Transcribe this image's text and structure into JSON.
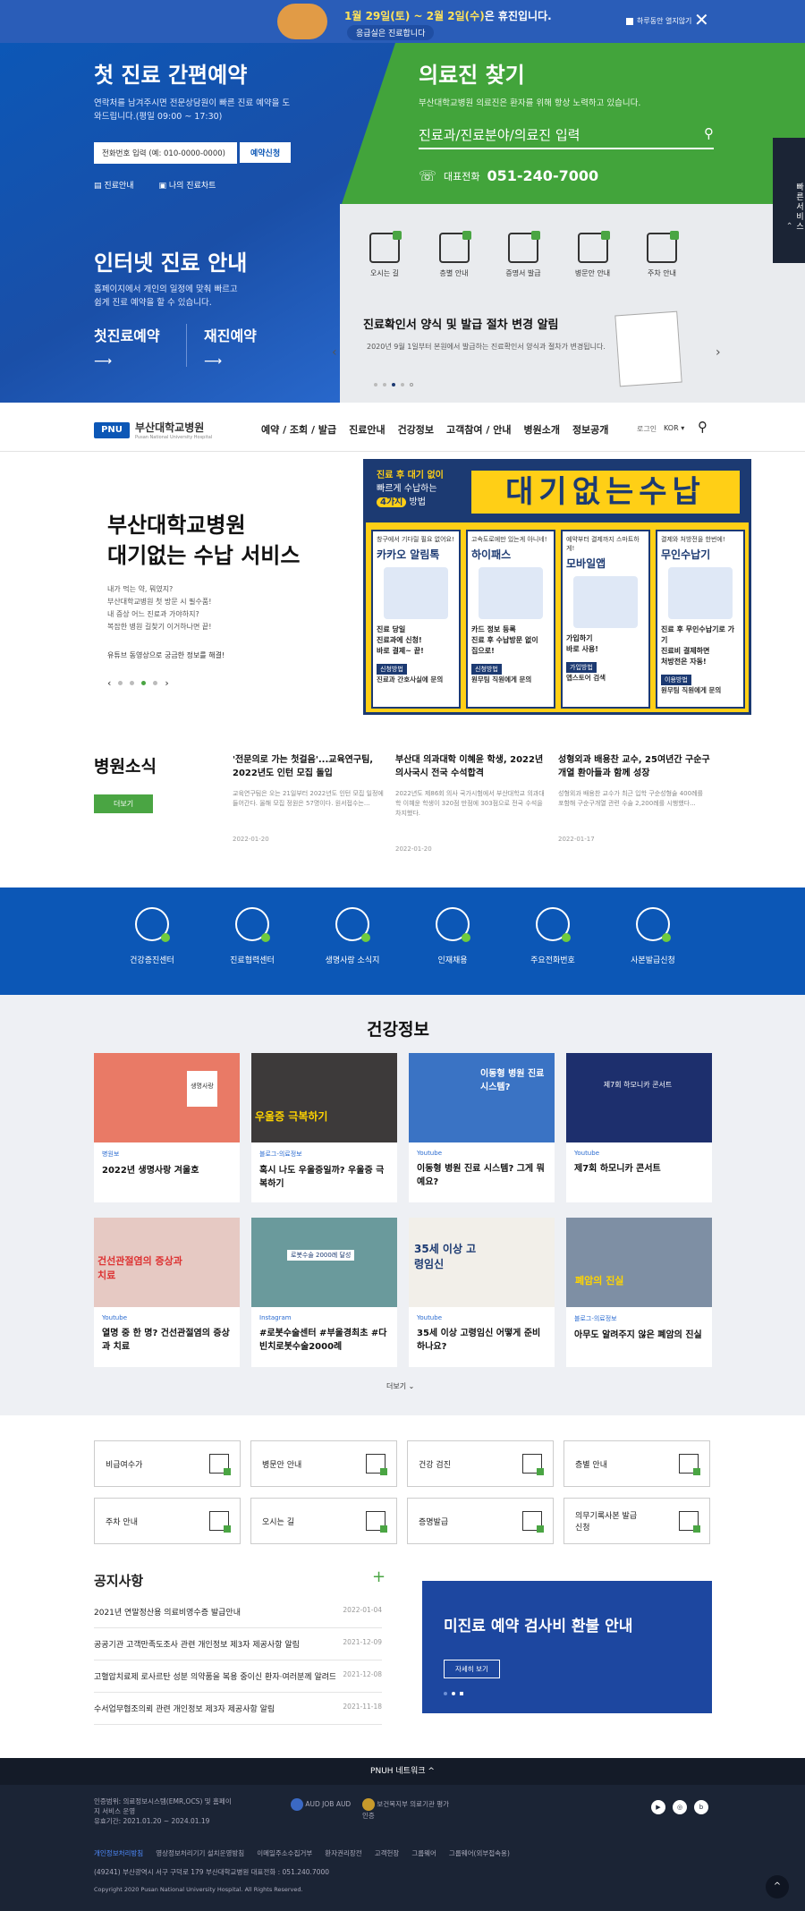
{
  "topnotice": {
    "pre": "1월 29일(토) ~ 2월 2일(수)",
    "post": "은 휴진입니다.",
    "pill": "응급실은 진료합니다",
    "today_hide": "하루동안 열지않기"
  },
  "hero": {
    "reserve": {
      "title": "첫 진료 간편예약",
      "desc": "연락처를 남겨주시면 전문상담원이 빠른 진료 예약을 도와드립니다.(평일 09:00 ~ 17:30)",
      "phone_placeholder": "전화번호 입력 (예: 010-0000-0000)",
      "apply": "예약신청",
      "link1": "진료안내",
      "link2": "나의 진료차트"
    },
    "find": {
      "title": "의료진 찾기",
      "desc": "부산대학교병원 의료진은 환자를 위해 항상 노력하고 있습니다.",
      "search_placeholder": "진료과/진료분야/의료진 입력",
      "tel_label": "대표전화",
      "tel": "051-240-7000"
    },
    "internet": {
      "title": "인터넷 진료 안내",
      "desc1": "홈페이지에서 개인의 일정에 맞춰 빠르고",
      "desc2": "쉽게 진료 예약을 할 수 있습니다.",
      "first": "첫진료예약",
      "re": "재진예약"
    },
    "icons": [
      "오시는 길",
      "층별 안내",
      "증명서 발급",
      "병문안 안내",
      "주차 안내"
    ],
    "slide": {
      "title": "진료확인서 양식 및 발급 절차 변경 알림",
      "desc": "2020년 9월 1일부터 본원에서 발급하는 진료확인서 양식과 절차가 변경됩니다."
    },
    "sidetab": "빠른서비스"
  },
  "gnb": {
    "logo_mark": "PNU",
    "logo_kr": "부산대학교병원",
    "logo_en": "Pusan National University Hospital",
    "menu": [
      "예약 / 조회 / 발급",
      "진료안내",
      "건강정보",
      "고객참여 / 안내",
      "병원소개",
      "정보공개"
    ],
    "login": "로그인",
    "lang": "KOR"
  },
  "main_banner": {
    "title1": "부산대학교병원",
    "title2": "대기없는 수납 서비스",
    "lines": [
      "내가 먹는 약, 뭐였지?",
      "부산대학교병원 첫 방문 시 필수품!",
      "내 증상 어느 진료과 가야하지?",
      "복잡한 병원 길찾기 이거하나면 끝!"
    ],
    "note": "유튜브 동영상으로 궁금한 정보를 해결!",
    "yb_small1": "진료 후 대기 없이",
    "yb_small2": "빠르게 수납하는",
    "yb_badge": "4가지",
    "yb_small3": "방법",
    "yb_big": "대기없는수납",
    "cards": [
      {
        "top": "창구에서 기다릴 필요 없어요!",
        "name": "카카오 알림톡",
        "f1": "진료 당일",
        "f2": "진료과에 신청!",
        "f3": "바로 결제~ 끝!",
        "tag": "신청방법",
        "foot": "진료과 간호사실에 문의"
      },
      {
        "top": "고속도로에만 있는게 아니네!",
        "name": "하이패스",
        "f1": "카드 정보 등록",
        "f2": "진료 후 수납방문 없이",
        "f3": "집으로!",
        "tag": "신청방법",
        "foot": "원무팀 직원에게 문의"
      },
      {
        "top": "예약부터 결제까지 스마트하게!",
        "name": "모바일앱",
        "f1": "가입하기",
        "f2": "바로 사용!",
        "f3": "",
        "tag": "가입방법",
        "foot": "앱스토어 검색"
      },
      {
        "top": "결제와 처방전을 한번에!",
        "name": "무인수납기",
        "f1": "진료 후 무인수납기로 가기",
        "f2": "진료비 결제하면",
        "f3": "처방전은 자동!",
        "tag": "이용방법",
        "foot": "원무팀 직원에게 문의"
      }
    ]
  },
  "news": {
    "title": "병원소식",
    "more": "더보기",
    "items": [
      {
        "title": "'전문의로 가는 첫걸음'...교육연구팀, 2022년도 인턴 모집 돌입",
        "desc": "교육연구팀은 오는 21일부터 2022년도 인턴 모집 일정에 들어간다. 올해 모집 정원은 57명이다. 원서접수는...",
        "date": "2022-01-20"
      },
      {
        "title": "부산대 의과대학 이혜윤 학생, 2022년 의사국시 전국 수석합격",
        "desc": "2022년도 제86회 의사 국가시험에서 부산대학교 의과대학 이혜윤 학생이 320점 만점에 303점으로 전국 수석을 차지했다.",
        "date": "2022-01-20"
      },
      {
        "title": "성형외과 배용찬 교수, 25여년간 구순구개열 환아들과 함께 성장",
        "desc": "성형외과 배용찬 교수가 최근 입학 구순성형술 400례를 포함해 구순구개열 관련 수술 2,200례를 시행했다...",
        "date": "2022-01-17"
      }
    ]
  },
  "quick": [
    "건강증진센터",
    "진료협력센터",
    "생명사랑 소식지",
    "인재채용",
    "주요전화번호",
    "사본발급신청"
  ],
  "health": {
    "title": "건강정보",
    "more": "더보기",
    "cards": [
      {
        "cat": "병원보",
        "title": "2022년 생명사랑 겨울호"
      },
      {
        "cat": "블로그-의료정보",
        "title": "혹시 나도 우울증일까? 우울증 극복하기"
      },
      {
        "cat": "Youtube",
        "title": "이동형 병원 진료 시스템? 그게 뭐예요?"
      },
      {
        "cat": "Youtube",
        "title": "제7회 하모니카 콘서트"
      },
      {
        "cat": "Youtube",
        "title": "열명 중 한 명? 건선관절염의 증상과 치료"
      },
      {
        "cat": "Instagram",
        "title": "#로봇수술센터 #부울경최초 #다빈치로봇수술2000례"
      },
      {
        "cat": "Youtube",
        "title": "35세 이상 고령임신 어떻게 준비하나요?"
      },
      {
        "cat": "블로그-의료정보",
        "title": "아무도 알려주지 않은 폐암의 진실"
      }
    ],
    "thumb_texts": [
      "생명사랑",
      "우울증 극복하기",
      "이동형 병원 진료 시스템?",
      "제7회 하모니카 콘서트",
      "건선관절염의 증상과 치료",
      "로봇수술 2000례 달성",
      "35세 이상 고령임신",
      "폐암의 진실"
    ]
  },
  "services": [
    "비급여수가",
    "병문안 안내",
    "건강 검진",
    "층별 안내",
    "주차 안내",
    "오시는 길",
    "증명발급",
    "의무기록사본 발급 신청"
  ],
  "notices": {
    "title": "공지사항",
    "plus": "+",
    "items": [
      {
        "t": "2021년 연말정산용 의료비영수증 발급안내",
        "d": "2022-01-04"
      },
      {
        "t": "공공기관 고객만족도조사 관련 개인정보 제3자 제공사항 알림",
        "d": "2021-12-09"
      },
      {
        "t": "고혈압치료제 로사르탄 성분 의약품을 복용 중이신 환자·여러분께 알려드...",
        "d": "2021-12-08"
      },
      {
        "t": "수서업무협조의뢰 관련 개인정보 제3자 제공사항 알림",
        "d": "2021-11-18"
      }
    ]
  },
  "refund": {
    "title": "미진료 예약 검사비 환불 안내",
    "btn": "자세히 보기"
  },
  "footer": {
    "network": "PNUH 네트워크",
    "cert1": "인증범위: 의료정보시스템(EMR,OCS) 및 홈페이지 서비스 운영",
    "cert2": "유효기간: 2021.01.20 ~ 2024.01.19",
    "cert3": "AUD JOB AUD",
    "cert4": "보건복지부 의료기관 평가인증",
    "links": [
      "개인정보처리방침",
      "영상정보처리기기 설치운영방침",
      "이메일주소수집거부",
      "환자권리장전",
      "고객헌장",
      "그룹웨어",
      "그룹웨어(외부접속용)"
    ],
    "address": "(49241) 부산광역시 서구 구덕로 179 부산대학교병원    대표전화 : 051.240.7000",
    "copy": "Copyright 2020 Pusan National University Hospital. All Rights Reserved."
  }
}
